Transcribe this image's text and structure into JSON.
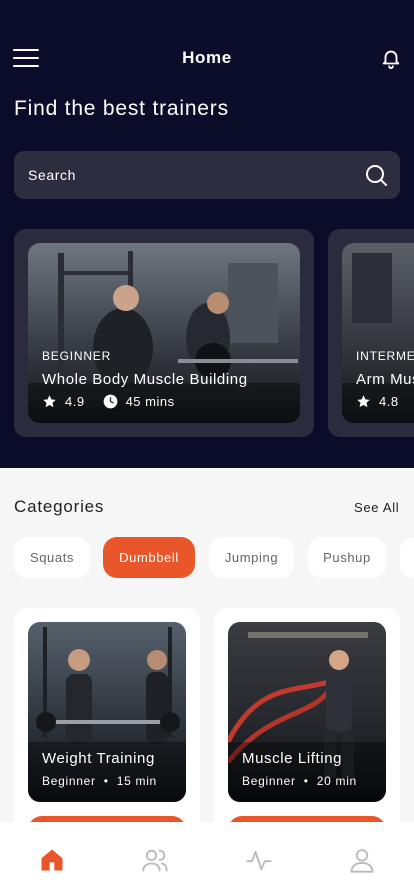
{
  "header": {
    "title": "Home"
  },
  "headline": "Find the best trainers",
  "search": {
    "placeholder": "Search"
  },
  "featured": [
    {
      "level": "BEGINNER",
      "name": "Whole Body Muscle Building",
      "rating": "4.9",
      "duration": "45 mins"
    },
    {
      "level": "INTERMEDIATE",
      "name": "Arm Muscle",
      "rating": "4.8",
      "duration": ""
    }
  ],
  "categories": {
    "title": "Categories",
    "see_all": "See All",
    "chips": [
      "Squats",
      "Dumbbell",
      "Jumping",
      "Pushup",
      ""
    ],
    "selected": "Dumbbell"
  },
  "workouts": [
    {
      "title": "Weight Training",
      "level": "Beginner",
      "duration": "15 min"
    },
    {
      "title": "Muscle Lifting",
      "level": "Beginner",
      "duration": "20 min"
    }
  ],
  "nav": {
    "items": [
      "home-icon",
      "users-icon",
      "activity-icon",
      "profile-icon"
    ],
    "active": "home-icon"
  },
  "colors": {
    "accent": "#e9562a",
    "header_bg": "#0b0c2a",
    "card_bg": "#2b2b3d"
  }
}
